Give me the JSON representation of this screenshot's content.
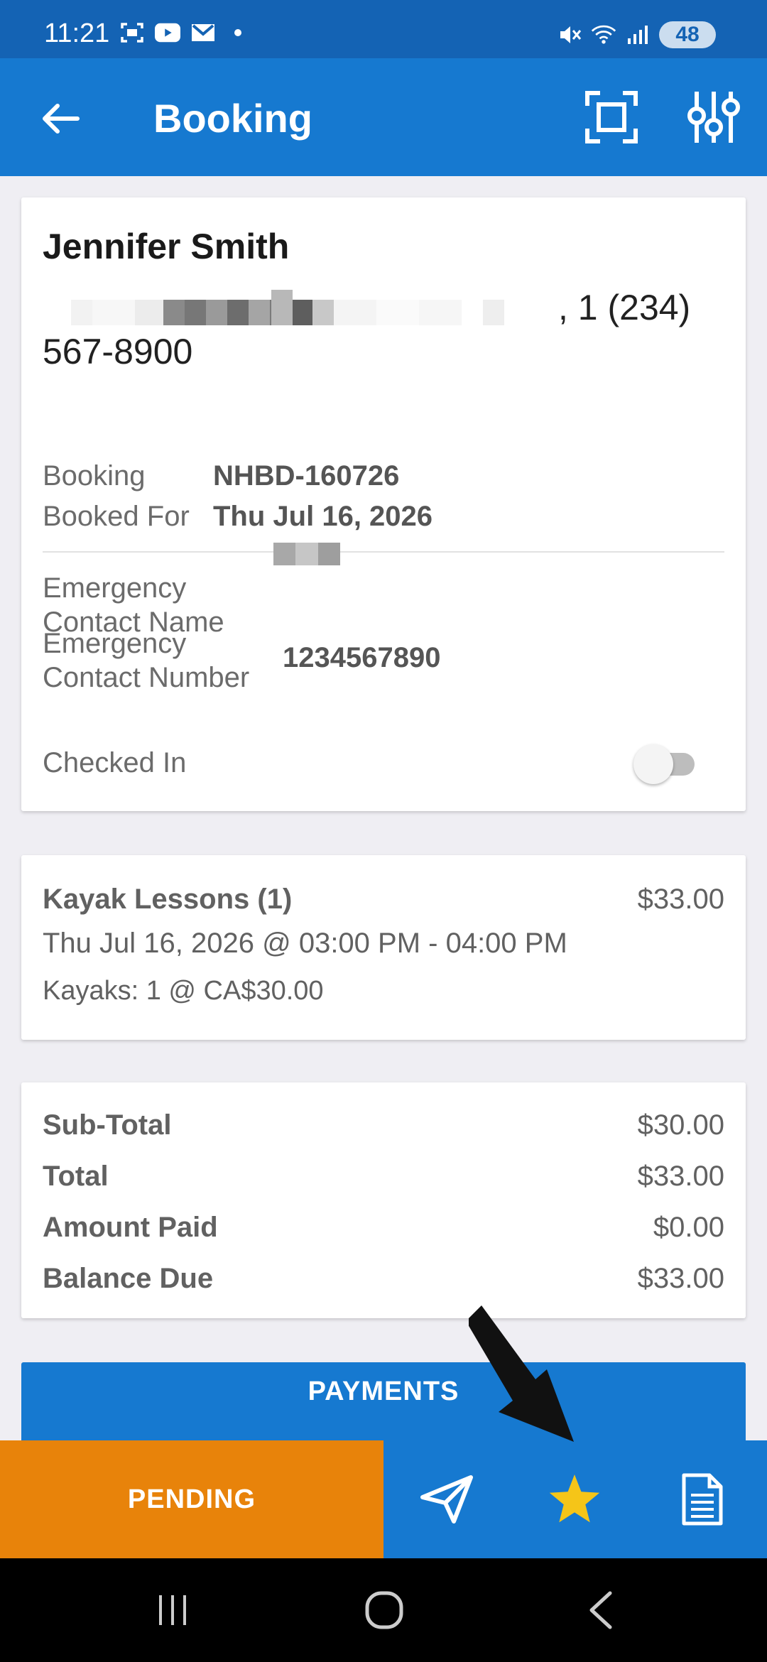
{
  "status_bar": {
    "time": "11:21",
    "battery": "48",
    "icons": [
      "screenshot-icon",
      "youtube-icon",
      "gmail-icon",
      "mute-icon",
      "wifi-icon",
      "signal-icon",
      "battery-icon"
    ]
  },
  "app_bar": {
    "title": "Booking",
    "icons": [
      "back-arrow-icon",
      "scan-icon",
      "filter-icon"
    ]
  },
  "customer": {
    "name": "Jennifer Smith",
    "contact_tail": ", 1 (234)",
    "contact_line2": "567-8900",
    "booking_label": "Booking",
    "booking_value": "NHBD-160726",
    "booked_for_label": "Booked For",
    "booked_for_value": "Thu Jul 16, 2026",
    "emergency_name_label_1": "Emergency",
    "emergency_name_label_2": "Contact Name",
    "emergency_number_label_1": "Emergency",
    "emergency_number_label_2": "Contact Number",
    "emergency_number_value": "1234567890",
    "checked_in_label": "Checked In",
    "checked_in": false
  },
  "item": {
    "title": "Kayak Lessons (1)",
    "price": "$33.00",
    "time": "Thu Jul 16, 2026 @ 03:00 PM - 04:00 PM",
    "qty": "Kayaks: 1 @ CA$30.00"
  },
  "totals": {
    "rows": [
      {
        "label": "Sub-Total",
        "value": "$30.00"
      },
      {
        "label": "Total",
        "value": "$33.00"
      },
      {
        "label": "Amount Paid",
        "value": "$0.00"
      },
      {
        "label": "Balance Due",
        "value": "$33.00"
      }
    ]
  },
  "payments_label": "PAYMENTS",
  "action_bar": {
    "pending_label": "PENDING",
    "icons": [
      "send-icon",
      "star-icon",
      "document-icon"
    ]
  },
  "colors": {
    "status_bar": "#1463b4",
    "primary": "#1679d0",
    "pending": "#e8830a",
    "star": "#f5c518",
    "background": "#efeef3"
  }
}
